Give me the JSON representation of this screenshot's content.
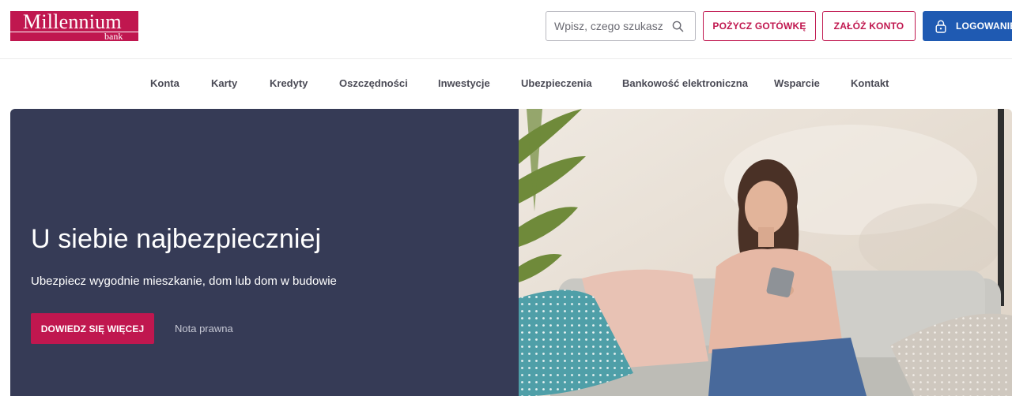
{
  "header": {
    "logo": {
      "name": "Millennium",
      "sub": "bank"
    },
    "search": {
      "placeholder": "Wpisz, czego szukasz",
      "value": ""
    },
    "buttons": {
      "loan": "POŻYCZ GOTÓWKĘ",
      "account": "ZAŁÓŻ KONTO",
      "login": "LOGOWANIE"
    }
  },
  "nav": {
    "items": [
      {
        "label": "Konta"
      },
      {
        "label": "Karty"
      },
      {
        "label": "Kredyty"
      },
      {
        "label": "Oszczędności"
      },
      {
        "label": "Inwestycje"
      },
      {
        "label": "Ubezpieczenia"
      },
      {
        "label": "Bankowość elektroniczna"
      },
      {
        "label": "Wsparcie"
      },
      {
        "label": "Kontakt"
      }
    ]
  },
  "hero": {
    "title": "U siebie najbezpieczniej",
    "subtitle": "Ubezpiecz wygodnie mieszkanie, dom lub dom w budowie",
    "cta": "DOWIEDZ SIĘ WIĘCEJ",
    "legal_link": "Nota prawna",
    "image_alt": "woman-on-sofa-with-phone"
  },
  "colors": {
    "brand": "#c0174f",
    "login": "#1f5ab2",
    "hero_panel": "#363b56",
    "nav_text": "#4a4a55"
  },
  "icons": {
    "search": "search-icon",
    "login": "lock-icon"
  }
}
